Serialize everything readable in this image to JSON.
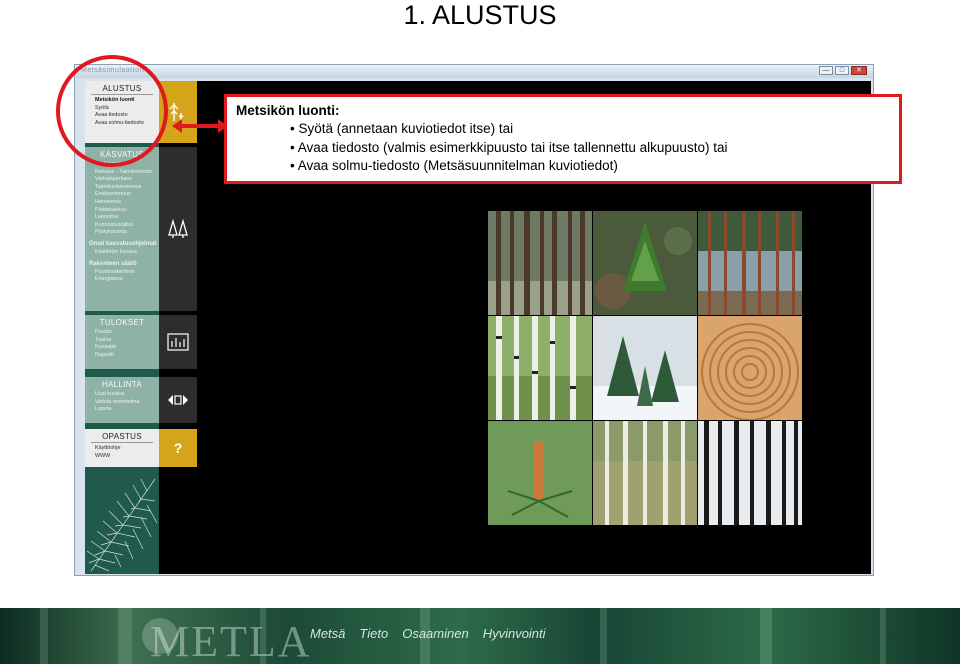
{
  "slide": {
    "title": "1. ALUSTUS"
  },
  "window": {
    "titlebar_text": "Metsäsimulaattori",
    "min_label": "—",
    "max_label": "□",
    "close_label": "✕"
  },
  "sidebar": {
    "alustus": {
      "header": "ALUSTUS",
      "items": [
        "Metsikön luonti",
        "Syötä",
        "Avaa tiedosto",
        "Avaa solmu-tiedosto"
      ]
    },
    "kasvatus": {
      "header": "KASVATUS",
      "items": [
        "Uudistaminen",
        "Raivaus - Taimikonhoito",
        "Varhaisperkaus",
        "Taimikonharvennus",
        "Ensiharvennus",
        "Harvennus",
        "Päätehakkuu",
        "Lannoitus",
        "Kunnostusojitus",
        "Pystykarsinta"
      ],
      "omat_header": "Omat kasvatusohjelmat",
      "omat_items": [
        "Käsittelyn kuvaus"
      ],
      "rakenne_header": "Rakenteen säätö",
      "rakenne_items": [
        "Puustorakenteet",
        "Energiapuu"
      ]
    },
    "tulokset": {
      "header": "TULOKSET",
      "items": [
        "Puusto",
        "Tuotos",
        "Kuvaajat",
        "Raportit"
      ]
    },
    "hallinta": {
      "header": "HALLINTA",
      "items": [
        "Uusi kuvaus",
        "Vaihda menetelmä",
        "Lopeta"
      ]
    },
    "opastus": {
      "header": "OPASTUS",
      "items": [
        "Käyttöohje",
        "WWW"
      ]
    }
  },
  "iconcol": {
    "help_label": "?"
  },
  "callout": {
    "title": "Metsikön luonti:",
    "bullets": [
      "Syötä (annetaan kuviotiedot itse) tai",
      "Avaa tiedosto (valmis esimerkkipuusto tai itse tallennettu alkupuusto) tai",
      "Avaa solmu-tiedosto (Metsäsuunnitelman kuviotiedot)"
    ]
  },
  "photos": [
    "pine-trunks",
    "spruce-seedling",
    "pine-forest",
    "birch-forest",
    "snowy-spruce-saplings",
    "tree-rings",
    "pine-shoot",
    "mixed-birch-forest",
    "snowy-forest"
  ],
  "footer": {
    "logo": "METLA",
    "tags": [
      "Metsä",
      "Tieto",
      "Osaaminen",
      "Hyvinvointi"
    ]
  },
  "colors": {
    "accent_red": "#e0191f",
    "sidebar_green": "#1f5a4c",
    "menu_yellow": "#d4a51b"
  }
}
